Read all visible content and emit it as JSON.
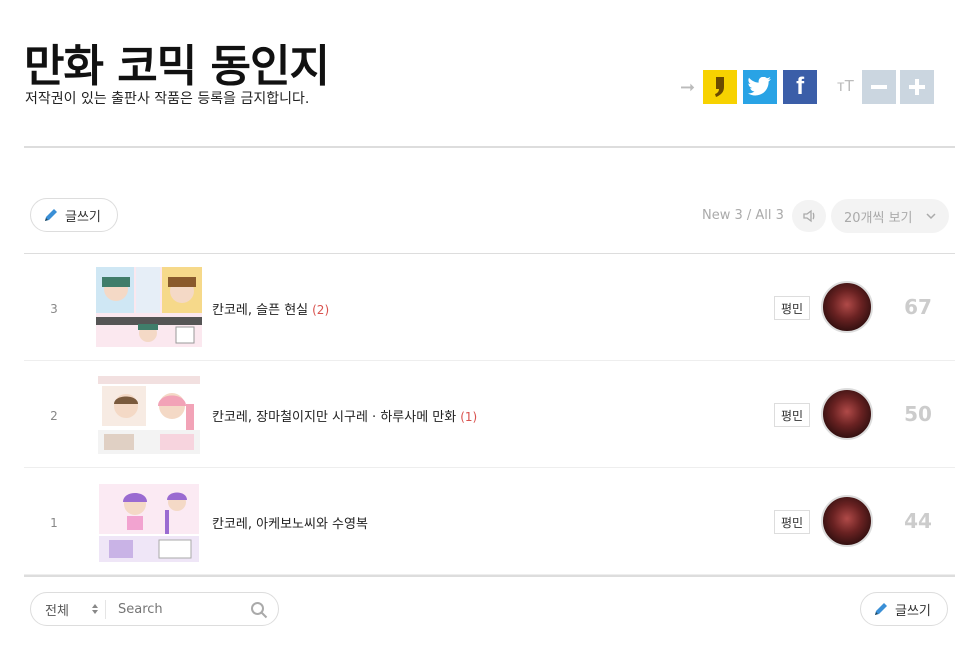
{
  "header": {
    "title": "만화 코믹 동인지",
    "subtitle": "저작권이 있는 출판사 작품은 등록을 금지합니다.",
    "share_icons": [
      "share-arrow-icon",
      "kakao-story-icon",
      "twitter-icon",
      "facebook-icon"
    ],
    "font_icons": [
      "font-size-icon",
      "minus-icon",
      "plus-icon"
    ]
  },
  "toolbar": {
    "write_label": "글쓰기",
    "count_text": "New 3 / All 3",
    "per_page_label": "20개씩 보기"
  },
  "posts": [
    {
      "num": "3",
      "title": "칸코레, 슬픈 현실",
      "comments": "(2)",
      "category": "평민",
      "views": "67"
    },
    {
      "num": "2",
      "title": "칸코레, 장마철이지만 시구레 · 하루사메 만화",
      "comments": "(1)",
      "category": "평민",
      "views": "50"
    },
    {
      "num": "1",
      "title": "칸코레, 아케보노씨와 수영복",
      "comments": "",
      "category": "평민",
      "views": "44"
    }
  ],
  "footer": {
    "search_scope": "전체",
    "search_placeholder": "Search",
    "write_label": "글쓰기"
  },
  "colors": {
    "kakao": "#f7d200",
    "twitter": "#29a3e5",
    "facebook": "#3b5ea8",
    "comment_count": "#d9534f",
    "font_buttons": "#cbd6e0"
  }
}
